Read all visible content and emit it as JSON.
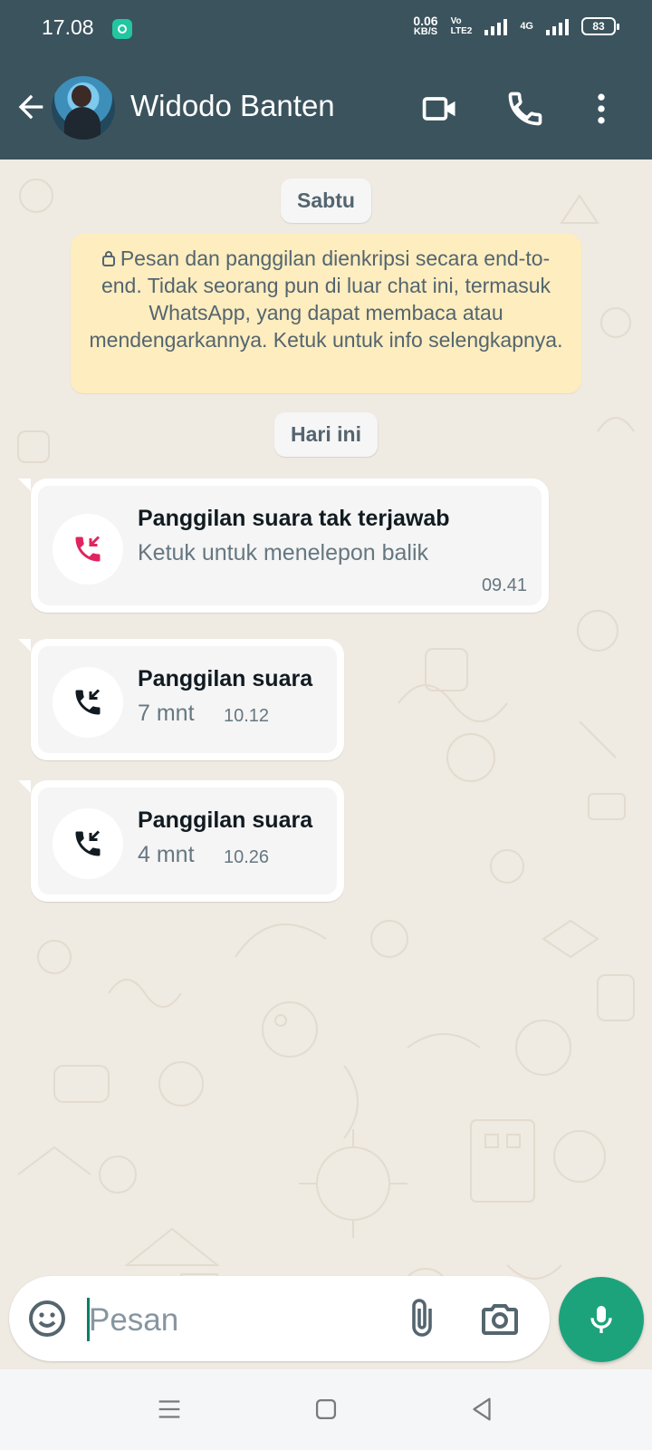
{
  "status_bar": {
    "time": "17.08",
    "net_speed_value": "0.06",
    "net_speed_unit": "KB/S",
    "volte_top": "Vo",
    "volte_bottom": "LTE2",
    "network": "4G",
    "battery": "83"
  },
  "header": {
    "contact_name": "Widodo Banten",
    "icons": [
      "back-arrow-icon",
      "video-call-icon",
      "voice-call-icon",
      "more-options-icon"
    ]
  },
  "chat": {
    "day_labels": [
      "Sabtu",
      "Hari ini"
    ],
    "encryption_notice": "Pesan dan panggilan dienkripsi secara end-to-end. Tidak seorang pun di luar chat ini, termasuk WhatsApp, yang dapat membaca atau mendengarkannya. Ketuk untuk info selengkapnya.",
    "calls": [
      {
        "type": "missed",
        "title": "Panggilan suara tak terjawab",
        "subtitle": "Ketuk untuk menelepon balik",
        "time": "09.41",
        "icon": "missed-call-icon",
        "color": "#e0245e"
      },
      {
        "type": "incoming",
        "title": "Panggilan suara",
        "subtitle": "7 mnt",
        "time": "10.12",
        "icon": "incoming-call-icon"
      },
      {
        "type": "incoming",
        "title": "Panggilan suara",
        "subtitle": "4 mnt",
        "time": "10.26",
        "icon": "incoming-call-icon"
      }
    ]
  },
  "composer": {
    "placeholder": "Pesan",
    "icons": [
      "emoji-icon",
      "attach-icon",
      "camera-icon",
      "mic-icon"
    ]
  },
  "colors": {
    "header": "#3b535d",
    "accent": "#1ca37c",
    "notice_bg": "#fdedbf",
    "chat_bg": "#efeae2"
  }
}
